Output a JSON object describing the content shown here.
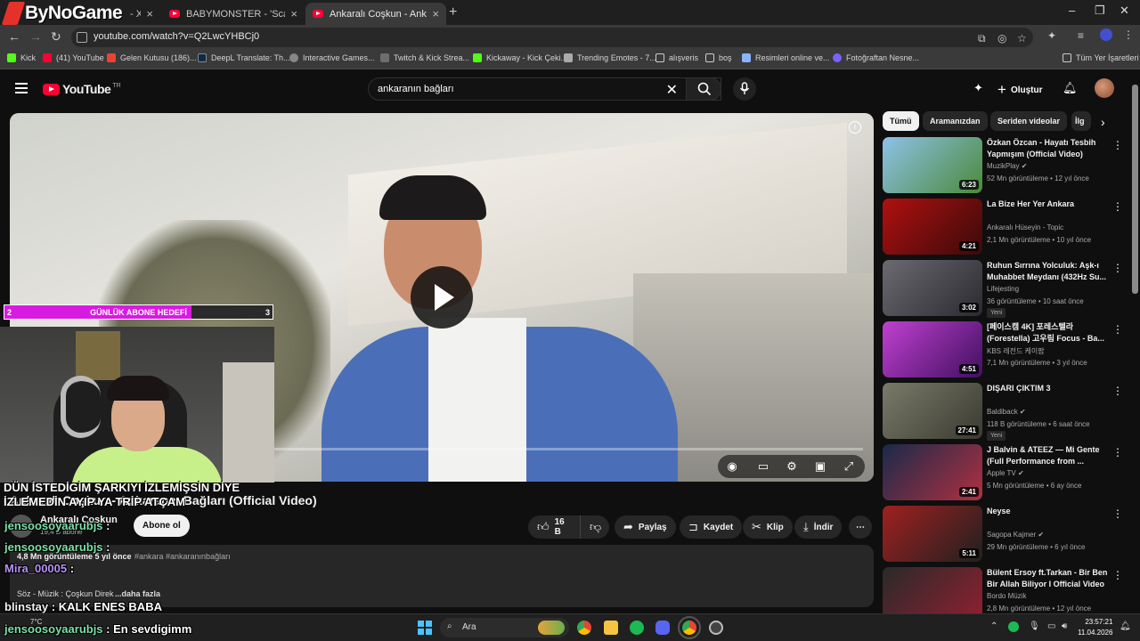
{
  "browser": {
    "tabs": [
      {
        "label": "- XO"
      },
      {
        "label": "BABYMONSTER - 'Scars To Your"
      },
      {
        "label": "Ankaralı Coşkun - Ankaranın Ba"
      }
    ],
    "new_tab": "+",
    "url": "youtube.com/watch?v=Q2LwcYHBCj0",
    "bookmarks": [
      {
        "label": "Kick",
        "color": "#53fc18"
      },
      {
        "label": "(41) YouTube",
        "color": "#ff0033"
      },
      {
        "label": "Gelen Kutusu (186)...",
        "color": "#ea4335"
      },
      {
        "label": "DeepL Translate: Th...",
        "color": "#0f2b46"
      },
      {
        "label": "Interactive Games...",
        "color": "#888888"
      },
      {
        "label": "Twitch & Kick Strea...",
        "color": "#6e6e6e"
      },
      {
        "label": "Kickaway - Kick Çeki...",
        "color": "#53fc18"
      },
      {
        "label": "Trending Emotes - 7...",
        "color": "#aaaaaa"
      },
      {
        "label": "alışveris",
        "color": "#aaaaaa"
      },
      {
        "label": "boş",
        "color": "#aaaaaa"
      },
      {
        "label": "Resimleri online ve...",
        "color": "#8ab4f8"
      },
      {
        "label": "Fotoğraftan Nesne...",
        "color": "#7b61ff"
      }
    ],
    "all_bookmarks": "Tüm Yer İşaretleri"
  },
  "overlay": {
    "brand": "ByNoGame",
    "goal": {
      "left": "2",
      "label": "GÜNLÜK ABONE HEDEFİ",
      "right": "3"
    },
    "alert_line1": "DÜN İSTEDİGİM ŞARKIYI İZLEMİŞSİN DİYE",
    "alert_line2": "İZLEMEDİN AYIP YA TRİP ATÇAM",
    "chat": [
      {
        "user": "jensoosoyaarubjs",
        "sep": " :",
        "text": ""
      },
      {
        "user": "jensoosoyaarubjs",
        "sep": " :",
        "text": ""
      },
      {
        "user": "Mira_00005",
        "sep": " :",
        "text": ""
      },
      {
        "user": "blinstay",
        "sep": " : ",
        "text": "KALK ENES BABA"
      },
      {
        "user": "jensoosoyaarubjs",
        "sep": " : ",
        "text": "En sevdigimm"
      }
    ]
  },
  "youtube": {
    "logo_text": "YouTube",
    "logo_region": "TR",
    "search_query": "ankaranın bağları",
    "create_label": "Oluştur",
    "video": {
      "title": "Ankaralı Coşkun - Ankaranın Bağları (Official Video)",
      "channel": "Ankaralı Coşkun",
      "subs": "19,4 B abone",
      "subscribe_label": "Abone ol",
      "likes": "16 B",
      "share_label": "Paylaş",
      "save_label": "Kaydet",
      "clip_label": "Klip",
      "download_label": "İndir",
      "stats": "4,8 Mn görüntüleme  5 yıl önce",
      "tags": "#ankara #ankaranınbağları",
      "desc_line3": "Söz - Müzik : Çoşkun Direk",
      "more": "...daha fazla",
      "progress": 0.0
    },
    "chips": [
      {
        "label": "Tümü",
        "active": true
      },
      {
        "label": "Aramanızdan",
        "active": false
      },
      {
        "label": "Seriden videolar",
        "active": false
      },
      {
        "label": "İlg",
        "active": false
      }
    ],
    "recommendations": [
      {
        "title": "Özkan Özcan - Hayatı Tesbih Yapmışım (Official Video)",
        "channel": "MuzikPlay",
        "verified": true,
        "meta": "52 Mn görüntüleme • 12 yıl önce",
        "duration": "6:23",
        "badge": "",
        "colors": [
          "#8ec1e8",
          "#4a8a3a"
        ]
      },
      {
        "title": "La Bize Her Yer Ankara",
        "channel": "Ankaralı Hüseyin - Topic",
        "verified": false,
        "meta": "2,1 Mn görüntüleme • 10 yıl önce",
        "duration": "4:21",
        "badge": "",
        "colors": [
          "#b01010",
          "#3a0a0a"
        ]
      },
      {
        "title": "Ruhun Sırrına Yolculuk: Aşk-ı Muhabbet Meydanı (432Hz Su...",
        "channel": "Lifejesting",
        "verified": false,
        "meta": "36 görüntüleme • 10 saat önce",
        "duration": "3:02",
        "badge": "Yeni",
        "colors": [
          "#6a6a70",
          "#2a2a30"
        ]
      },
      {
        "title": "[페이스캠 4K] 포레스텔라(Forestella) 고우림 Focus - Ba...",
        "channel": "KBS 레전드 케이팝",
        "verified": false,
        "meta": "7,1 Mn görüntüleme • 3 yıl önce",
        "duration": "4:51",
        "badge": "",
        "colors": [
          "#c040d0",
          "#401060"
        ]
      },
      {
        "title": "DIŞARI ÇIKTIM 3",
        "channel": "Baldiback",
        "verified": true,
        "meta": "118 B görüntüleme • 6 saat önce",
        "duration": "27:41",
        "badge": "Yeni",
        "colors": [
          "#7a7a6a",
          "#3a3a30"
        ]
      },
      {
        "title": "J Balvin & ATEEZ — Mi Gente (Full Performance from ...",
        "channel": "Apple TV",
        "verified": true,
        "meta": "5 Mn görüntüleme • 6 ay önce",
        "duration": "2:41",
        "badge": "",
        "colors": [
          "#1a2a4a",
          "#b03040"
        ]
      },
      {
        "title": "Neyse",
        "channel": "Sagopa Kajmer",
        "verified": true,
        "meta": "29 Mn görüntüleme • 6 yıl önce",
        "duration": "5:11",
        "badge": "",
        "colors": [
          "#a02020",
          "#202020"
        ]
      },
      {
        "title": "Bülent Ersoy ft.Tarkan - Bir Ben Bir Allah Biliyor I Official Video",
        "channel": "Bordo Müzik",
        "verified": false,
        "meta": "2,8 Mn görüntüleme • 12 yıl önce",
        "duration": "",
        "badge": "",
        "colors": [
          "#2a2a2a",
          "#902030"
        ]
      }
    ]
  },
  "taskbar": {
    "weather": "7°C",
    "search_placeholder": "Ara",
    "time": "23:57:21",
    "date": "11.04.2026"
  }
}
